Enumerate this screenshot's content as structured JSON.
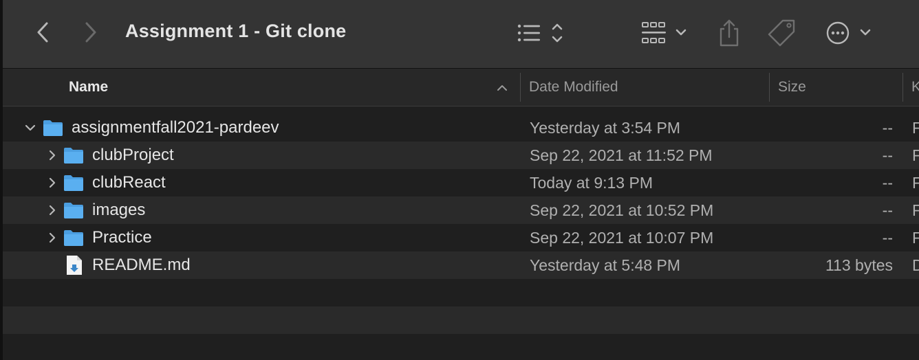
{
  "window": {
    "title": "Assignment 1 - Git clone"
  },
  "toolbar": {
    "back_icon": "chevron-left-icon",
    "forward_icon": "chevron-right-icon",
    "view_icon": "list-view-icon",
    "group_icon": "group-grid-icon",
    "share_icon": "share-icon",
    "tag_icon": "tag-icon",
    "more_icon": "ellipsis-circle-icon"
  },
  "columns": {
    "name": "Name",
    "date": "Date Modified",
    "size": "Size",
    "kind": "K"
  },
  "rows": [
    {
      "name": "assignmentfall2021-pardeev",
      "date": "Yesterday at 3:54 PM",
      "size": "--",
      "kind": "F",
      "type": "folder",
      "expanded": true,
      "depth": 0
    },
    {
      "name": "clubProject",
      "date": "Sep 22, 2021 at 11:52 PM",
      "size": "--",
      "kind": "F",
      "type": "folder",
      "expanded": false,
      "depth": 1
    },
    {
      "name": "clubReact",
      "date": "Today at 9:13 PM",
      "size": "--",
      "kind": "F",
      "type": "folder",
      "expanded": false,
      "depth": 1
    },
    {
      "name": "images",
      "date": "Sep 22, 2021 at 10:52 PM",
      "size": "--",
      "kind": "F",
      "type": "folder",
      "expanded": false,
      "depth": 1
    },
    {
      "name": "Practice",
      "date": "Sep 22, 2021 at 10:07 PM",
      "size": "--",
      "kind": "F",
      "type": "folder",
      "expanded": false,
      "depth": 1
    },
    {
      "name": "README.md",
      "date": "Yesterday at 5:48 PM",
      "size": "113 bytes",
      "kind": "D",
      "type": "file",
      "depth": 1
    }
  ],
  "colors": {
    "folder": "#5aaff0",
    "toolbar_bg": "#343434",
    "row_alt": "#2a2a2a"
  }
}
